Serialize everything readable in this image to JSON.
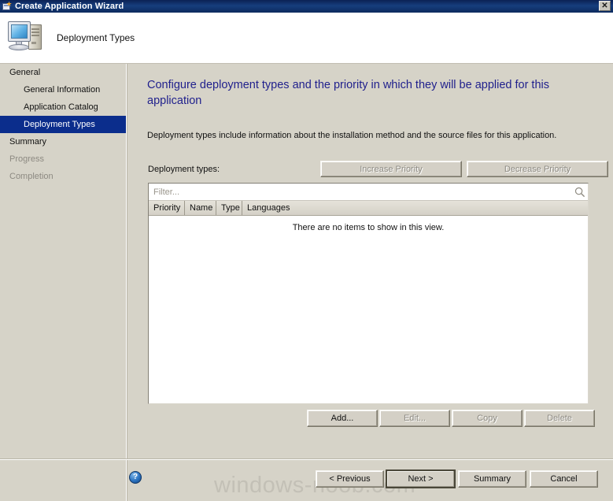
{
  "window": {
    "title": "Create Application Wizard",
    "close_label": "✕",
    "app_icon": "wizard-window-icon"
  },
  "header": {
    "title": "Deployment Types",
    "icon": "computer-icon"
  },
  "sidebar": {
    "items": [
      {
        "label": "General",
        "level": 1,
        "state": "normal"
      },
      {
        "label": "General Information",
        "level": 2,
        "state": "normal"
      },
      {
        "label": "Application Catalog",
        "level": 2,
        "state": "normal"
      },
      {
        "label": "Deployment Types",
        "level": 2,
        "state": "selected"
      },
      {
        "label": "Summary",
        "level": 1,
        "state": "normal"
      },
      {
        "label": "Progress",
        "level": 1,
        "state": "disabled"
      },
      {
        "label": "Completion",
        "level": 1,
        "state": "disabled"
      }
    ]
  },
  "main": {
    "heading": "Configure deployment types and the priority in which they will be applied for this application",
    "description": "Deployment types include information about the installation method and the source files for this application.",
    "deployment_types_label": "Deployment types:",
    "increase_priority_label": "Increase Priority",
    "decrease_priority_label": "Decrease Priority",
    "filter_placeholder": "Filter...",
    "filter_value": "",
    "search_icon": "magnifier-icon",
    "columns": [
      "Priority",
      "Name",
      "Type",
      "Languages"
    ],
    "rows": [],
    "empty_message": "There are no items to show in this view.",
    "add_label": "Add...",
    "edit_label": "Edit...",
    "copy_label": "Copy",
    "delete_label": "Delete"
  },
  "footer": {
    "help_icon": "help-question-icon",
    "help_glyph": "?",
    "watermark": "windows-noob.com",
    "previous_label": "< Previous",
    "next_label": "Next >",
    "summary_label": "Summary",
    "cancel_label": "Cancel"
  },
  "colors": {
    "titlebar": "#0d2a5e",
    "body": "#d6d3c8",
    "heading_text": "#1f1f8c",
    "selection": "#0b2d8c",
    "disabled_text": "#8d8a82",
    "list_background": "#ffffff"
  }
}
